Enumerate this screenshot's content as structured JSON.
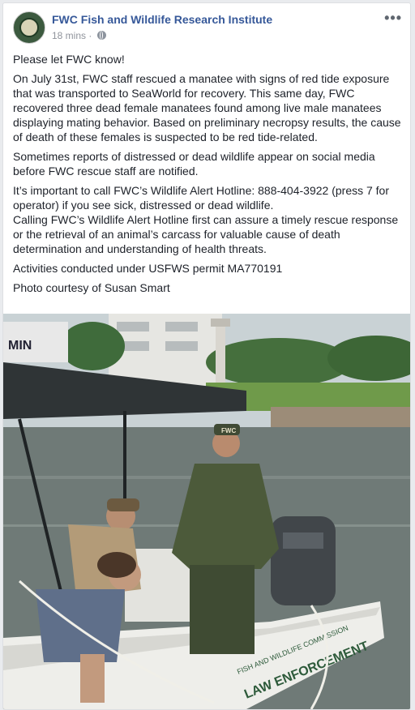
{
  "post": {
    "page_name": "FWC Fish and Wildlife Research Institute",
    "timestamp": "18 mins",
    "separator": "·",
    "privacy_icon": "globe-icon",
    "more_icon": "more-options-icon",
    "paragraphs": [
      "Please let FWC know!",
      "On July 31st, FWC staff rescued a manatee with signs of red tide exposure that was transported to SeaWorld for recovery. This same day, FWC recovered three dead female manatees found among live male manatees displaying mating behavior. Based on preliminary necropsy results, the cause of death of these females is suspected to be red tide-related.",
      "Sometimes reports of distressed or dead wildlife appear on social media before FWC rescue staff are notified.",
      "It’s important to call FWC’s Wildlife Alert Hotline: 888-404-3922 (press 7 for operator) if you see sick, distressed or dead wildlife.",
      "Calling FWC’s Wildlife Alert Hotline first can assure a timely rescue response or the retrieval of an animal’s carcass for valuable cause of death determination and understanding of health threats.",
      "Activities conducted under USFWS permit MA770191",
      "Photo courtesy of Susan Smart"
    ]
  },
  "photo": {
    "brand_text": "MIN",
    "cap_text": "FWC",
    "hull_text_1": "FISH AND WILDLIFE COMMISSION",
    "hull_text_2": "LAW ENFORCEMENT"
  }
}
